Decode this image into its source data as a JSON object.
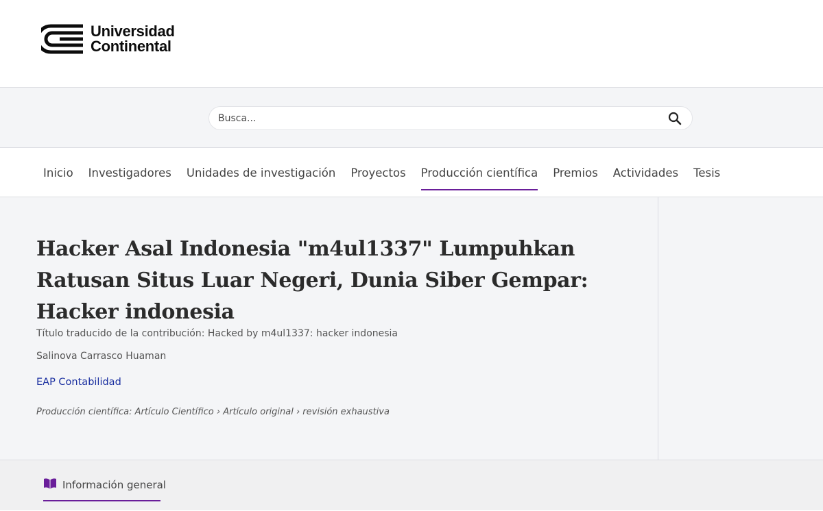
{
  "header": {
    "logo_line1": "Universidad",
    "logo_line2": "Continental",
    "logo_icon": "universidad-continental-logo-mark"
  },
  "search": {
    "placeholder": "Busca...",
    "icon": "search-icon"
  },
  "nav": {
    "items": [
      {
        "label": "Inicio"
      },
      {
        "label": "Investigadores"
      },
      {
        "label": "Unidades de investigación"
      },
      {
        "label": "Proyectos"
      },
      {
        "label": "Producción científica"
      },
      {
        "label": "Premios"
      },
      {
        "label": "Actividades"
      },
      {
        "label": "Tesis"
      }
    ],
    "active_index": 4,
    "accent_color": "#6a1e9a"
  },
  "article": {
    "title": "Hacker Asal Indonesia \"m4ul1337\" Lumpuhkan Ratusan Situs Luar Negeri, Dunia Siber Gempar: Hacker indonesia",
    "translated_title": "Título traducido de la contribución: Hacked by m4ul1337: hacker indonesia",
    "author": "Salinova Carrasco Huaman",
    "unit": "EAP Contabilidad",
    "type_line": "Producción científica: Artículo Científico › Artículo original › revisión exhaustiva"
  },
  "tabs": {
    "items": [
      {
        "label": "Información general",
        "icon": "book-icon"
      }
    ]
  },
  "colors": {
    "accent": "#6a1e9a",
    "link": "#1a2fa0",
    "band_bg": "#f4f5f7"
  }
}
